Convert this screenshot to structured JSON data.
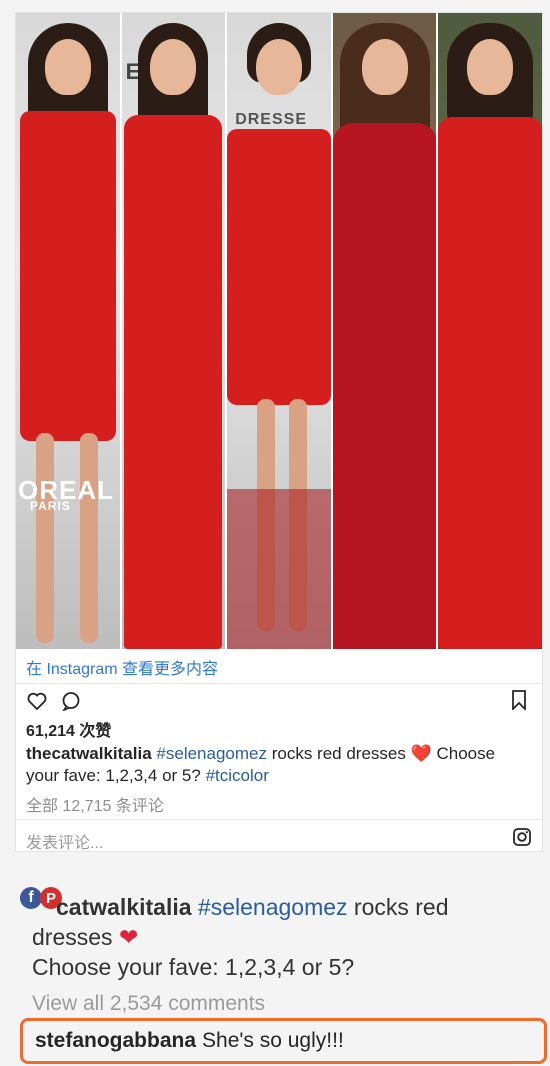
{
  "post": {
    "link_text": "在 Instagram 查看更多内容",
    "likes": "61,214 次赞",
    "username": "thecatwalkitalia",
    "hashtag": "#selenagomez",
    "caption_mid": " rocks red dresses ",
    "heart": "❤️",
    "caption_end": " Choose your fave: 1,2,3,4 or 5? ",
    "hashtag2": "#tcicolor",
    "comments_link": "全部 12,715 条评论",
    "comment_placeholder": "发表评论...",
    "collage_bg_texts": [
      "OREAL",
      "PARIS",
      "ERIC",
      "DRESSE"
    ]
  },
  "share": {
    "fb": "f",
    "pin": "P"
  },
  "repost": {
    "username_partial": "catwalkitalia",
    "hashtag": "#selenagomez",
    "text1": " rocks red dresses ",
    "heart": "❤",
    "text2": "Choose your fave: 1,2,3,4 or 5?",
    "view_all": "View all 2,534 comments"
  },
  "highlight_comment": {
    "username": "stefanogabbana",
    "text": "She's so ugly!!!"
  },
  "colors": {
    "accent_link": "#2f79d9",
    "highlight_border": "#ef6a2c",
    "dress_red": "#d51f1f"
  }
}
